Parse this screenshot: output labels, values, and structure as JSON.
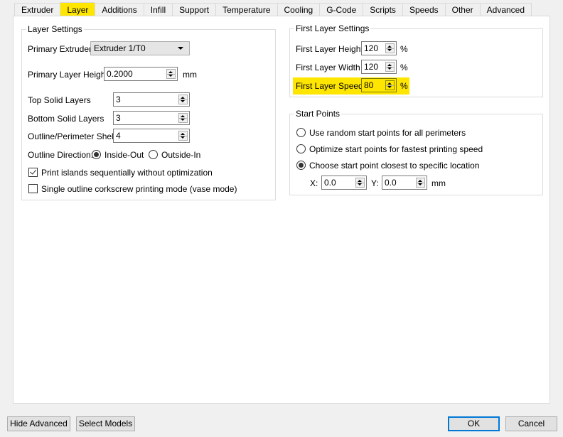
{
  "tabs": [
    {
      "label": "Extruder",
      "active": false
    },
    {
      "label": "Layer",
      "active": true
    },
    {
      "label": "Additions",
      "active": false
    },
    {
      "label": "Infill",
      "active": false
    },
    {
      "label": "Support",
      "active": false
    },
    {
      "label": "Temperature",
      "active": false
    },
    {
      "label": "Cooling",
      "active": false
    },
    {
      "label": "G-Code",
      "active": false
    },
    {
      "label": "Scripts",
      "active": false
    },
    {
      "label": "Speeds",
      "active": false
    },
    {
      "label": "Other",
      "active": false
    },
    {
      "label": "Advanced",
      "active": false
    }
  ],
  "highlight_color": "#ffe600",
  "layer_settings": {
    "title": "Layer Settings",
    "primary_extruder": {
      "label": "Primary Extruder",
      "value": "Extruder 1/T0"
    },
    "primary_layer_height": {
      "label": "Primary Layer Height",
      "value": "0.2000",
      "unit": "mm"
    },
    "top_solid_layers": {
      "label": "Top Solid Layers",
      "value": "3"
    },
    "bottom_solid_layers": {
      "label": "Bottom Solid Layers",
      "value": "3"
    },
    "outline_shells": {
      "label": "Outline/Perimeter Shells",
      "value": "4"
    },
    "outline_direction": {
      "label": "Outline Direction:",
      "options": [
        {
          "label": "Inside-Out",
          "selected": true
        },
        {
          "label": "Outside-In",
          "selected": false
        }
      ]
    },
    "print_islands": {
      "label": "Print islands sequentially without optimization",
      "checked": true
    },
    "vase_mode": {
      "label": "Single outline corkscrew printing mode (vase mode)",
      "checked": false
    }
  },
  "first_layer_settings": {
    "title": "First Layer Settings",
    "height": {
      "label": "First Layer Height",
      "value": "120",
      "unit": "%"
    },
    "width": {
      "label": "First Layer Width",
      "value": "120",
      "unit": "%"
    },
    "speed": {
      "label": "First Layer Speed",
      "value": "80",
      "unit": "%",
      "highlighted": true
    }
  },
  "start_points": {
    "title": "Start Points",
    "options": [
      {
        "label": "Use random start points for all perimeters",
        "selected": false
      },
      {
        "label": "Optimize start points for fastest printing speed",
        "selected": false
      },
      {
        "label": "Choose start point closest to specific location",
        "selected": true
      }
    ],
    "x": {
      "label": "X:",
      "value": "0.0"
    },
    "y": {
      "label": "Y:",
      "value": "0.0"
    },
    "unit": "mm"
  },
  "footer": {
    "hide_advanced": "Hide Advanced",
    "select_models": "Select Models",
    "ok": "OK",
    "cancel": "Cancel"
  }
}
